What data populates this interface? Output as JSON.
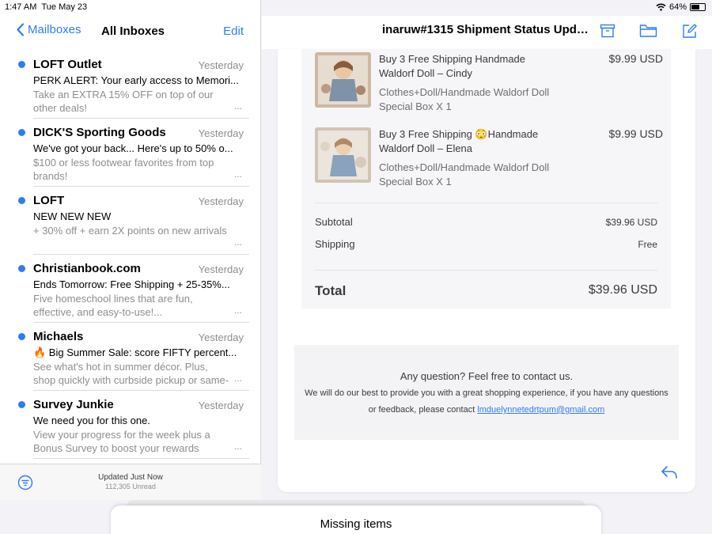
{
  "status_bar": {
    "time": "1:47 AM",
    "date": "Tue May 23",
    "battery": "64%",
    "battery_level": 0.64
  },
  "mail_nav": {
    "back_label": "Mailboxes",
    "title": "All Inboxes",
    "edit_label": "Edit"
  },
  "messages": [
    {
      "sender": "LOFT Outlet",
      "date": "Yesterday",
      "subject": "PERK ALERT: Your early access to Memori...",
      "preview": "Take an EXTRA 15% OFF on top of our other deals!"
    },
    {
      "sender": "DICK'S Sporting Goods",
      "date": "Yesterday",
      "subject": "We've got your back... Here's up to 50% o...",
      "preview": "$100 or less footwear favorites from top brands!"
    },
    {
      "sender": "LOFT",
      "date": "Yesterday",
      "subject": "NEW NEW NEW",
      "preview": "+ 30% off + earn 2X points on new arrivals"
    },
    {
      "sender": "Christianbook.com",
      "date": "Yesterday",
      "subject": "Ends Tomorrow: Free Shipping + 25-35%...",
      "preview": "Five homeschool lines that are fun, effective, and easy-to-use!..."
    },
    {
      "sender": "Michaels",
      "date": "Yesterday",
      "subject": "🔥 Big Summer Sale: score FIFTY percent...",
      "preview": "See what's hot in summer décor. Plus, shop quickly with curbside pickup or same-day..."
    },
    {
      "sender": "Survey Junkie",
      "date": "Yesterday",
      "subject": "We need you for this one.",
      "preview": "View your progress for the week plus a Bonus Survey to boost your rewards"
    }
  ],
  "more_glyph": "...",
  "toolbar": {
    "updated": "Updated Just Now",
    "unread": "112,305 Unread"
  },
  "email": {
    "subject": "inaruw#1315 Shipment Status Upda...",
    "products": [
      {
        "name": "Buy 3 Free Shipping Handmade Waldorf Doll – Cindy",
        "variant": "Clothes+Doll/Handmade Waldorf Doll Special Box X 1",
        "price": "$9.99 USD"
      },
      {
        "name": "Buy 3 Free Shipping 😳Handmade Waldorf Doll – Elena",
        "variant": "Clothes+Doll/Handmade Waldorf Doll Special Box X 1",
        "price": "$9.99 USD"
      }
    ],
    "subtotal_label": "Subtotal",
    "subtotal_value": "$39.96 USD",
    "shipping_label": "Shipping",
    "shipping_value": "Free",
    "total_label": "Total",
    "total_value": "$39.96 USD",
    "contact_title": "Any question? Feel free to contact us.",
    "contact_text": "We will do our best to provide you with a great shopping experience, if you have any questions or feedback, please contact",
    "contact_email": "lmduelynnetedrtpum@gmail.com"
  },
  "sheet": {
    "title": "Missing items"
  },
  "colors": {
    "accent": "#2f7cf6",
    "unread_dot": "#2f7cf6",
    "secondary_text": "#8e8e93"
  },
  "icons": [
    "chevron-left-icon",
    "filter-icon",
    "archive-icon",
    "folder-icon",
    "compose-icon",
    "reply-icon",
    "wifi-icon",
    "battery-icon"
  ]
}
